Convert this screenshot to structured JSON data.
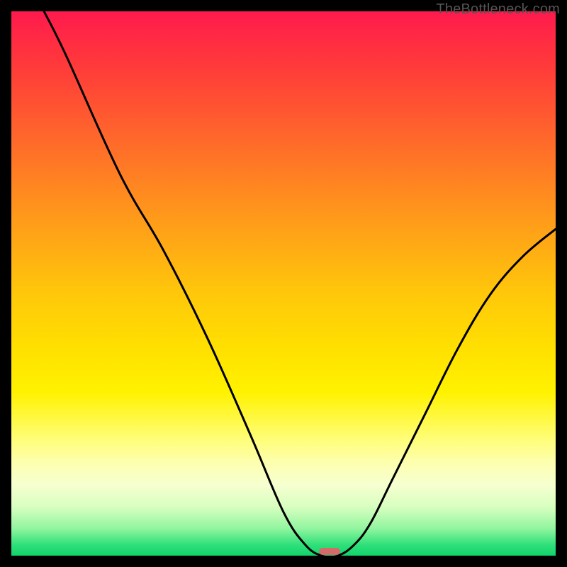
{
  "attribution": "TheBottleneck.com",
  "marker_color": "#d46a6a",
  "chart_data": {
    "type": "line",
    "title": "",
    "xlabel": "",
    "ylabel": "",
    "xlim": [
      0,
      100
    ],
    "ylim": [
      0,
      100
    ],
    "grid": false,
    "legend": false,
    "series": [
      {
        "name": "bottleneck-curve",
        "x": [
          6,
          10,
          20,
          28,
          36,
          44,
          50,
          54,
          57,
          60,
          63,
          66,
          70,
          76,
          82,
          88,
          94,
          100
        ],
        "y": [
          100,
          92,
          70,
          56,
          40,
          22,
          8,
          2,
          0,
          0,
          2,
          6,
          14,
          26,
          38,
          48,
          55,
          60
        ]
      }
    ],
    "optimal_marker": {
      "x": 58.5,
      "y": 0.8
    },
    "background_gradient_stops": [
      {
        "pos": 0,
        "color": "#ff1a4d"
      },
      {
        "pos": 10,
        "color": "#ff3a3a"
      },
      {
        "pos": 24,
        "color": "#ff6a2a"
      },
      {
        "pos": 38,
        "color": "#ff9a1a"
      },
      {
        "pos": 52,
        "color": "#ffc80a"
      },
      {
        "pos": 62,
        "color": "#ffe000"
      },
      {
        "pos": 70,
        "color": "#fff200"
      },
      {
        "pos": 78,
        "color": "#fffd70"
      },
      {
        "pos": 83,
        "color": "#fdffb0"
      },
      {
        "pos": 87,
        "color": "#f6ffd0"
      },
      {
        "pos": 91,
        "color": "#d8ffc0"
      },
      {
        "pos": 95,
        "color": "#92f5a0"
      },
      {
        "pos": 98,
        "color": "#2fe07a"
      },
      {
        "pos": 100,
        "color": "#12d36b"
      }
    ]
  }
}
